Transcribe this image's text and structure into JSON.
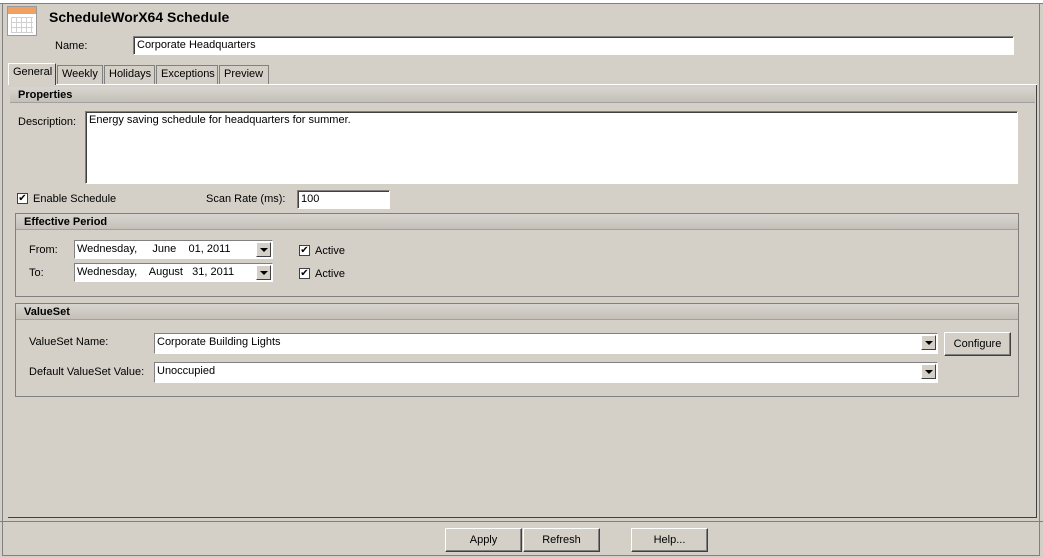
{
  "window": {
    "title": "ScheduleWorX64 Schedule"
  },
  "header": {
    "name_label": "Name:",
    "name_value": "Corporate Headquarters",
    "icon": "calendar-icon"
  },
  "tabs": [
    {
      "label": "General",
      "active": true
    },
    {
      "label": "Weekly",
      "active": false
    },
    {
      "label": "Holidays",
      "active": false
    },
    {
      "label": "Exceptions",
      "active": false
    },
    {
      "label": "Preview",
      "active": false
    }
  ],
  "properties": {
    "heading": "Properties",
    "description_label": "Description:",
    "description_value": "Energy saving schedule for headquarters for summer.",
    "enable_label": "Enable Schedule",
    "enable_checked": true,
    "scan_rate_label": "Scan Rate (ms):",
    "scan_rate_value": "100"
  },
  "effective_period": {
    "heading": "Effective Period",
    "from_label": "From:",
    "from_value": "Wednesday,     June    01, 2011",
    "to_label": "To:",
    "to_value": "Wednesday,    August   31, 2011",
    "active_label": "Active",
    "from_active": true,
    "to_active": true
  },
  "valueset": {
    "heading": "ValueSet",
    "name_label": "ValueSet Name:",
    "name_value": "Corporate Building Lights",
    "default_label": "Default ValueSet Value:",
    "default_value": "Unoccupied",
    "configure_label": "Configure"
  },
  "footer": {
    "apply_label": "Apply",
    "refresh_label": "Refresh",
    "help_label": "Help..."
  }
}
